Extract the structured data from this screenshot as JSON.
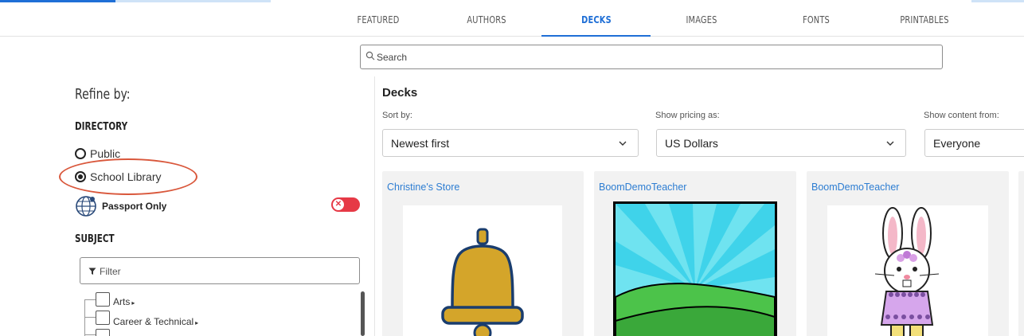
{
  "tabs": [
    {
      "label": "FEATURED",
      "active": false
    },
    {
      "label": "AUTHORS",
      "active": false
    },
    {
      "label": "DECKS",
      "active": true
    },
    {
      "label": "IMAGES",
      "active": false
    },
    {
      "label": "FONTS",
      "active": false
    },
    {
      "label": "PRINTABLES",
      "active": false
    }
  ],
  "search": {
    "placeholder": "Search",
    "value": ""
  },
  "sidebar": {
    "refine_title": "Refine by:",
    "directory": {
      "heading": "DIRECTORY",
      "options": [
        {
          "label": "Public",
          "selected": false
        },
        {
          "label": "School Library",
          "selected": true
        }
      ],
      "passport_label": "Passport Only",
      "passport_enabled": false
    },
    "subject": {
      "heading": "SUBJECT",
      "filter_placeholder": "Filter",
      "items": [
        {
          "label": "Arts"
        },
        {
          "label": "Career & Technical"
        }
      ]
    }
  },
  "main": {
    "title": "Decks",
    "sort": {
      "label": "Sort by:",
      "value": "Newest first"
    },
    "pricing": {
      "label": "Show pricing as:",
      "value": "US Dollars"
    },
    "content_from": {
      "label": "Show content from:",
      "value": "Everyone"
    },
    "cards": [
      {
        "author": "Christine's Store",
        "image": "bell-icon"
      },
      {
        "author": "BoomDemoTeacher",
        "image": "hills-sunburst-picture"
      },
      {
        "author": "BoomDemoTeacher",
        "image": "bunny-picture"
      }
    ]
  },
  "colors": {
    "accent": "#1f6fd6",
    "link": "#2d7dd2",
    "toggle_off": "#e63946",
    "highlight": "#d9573b"
  }
}
